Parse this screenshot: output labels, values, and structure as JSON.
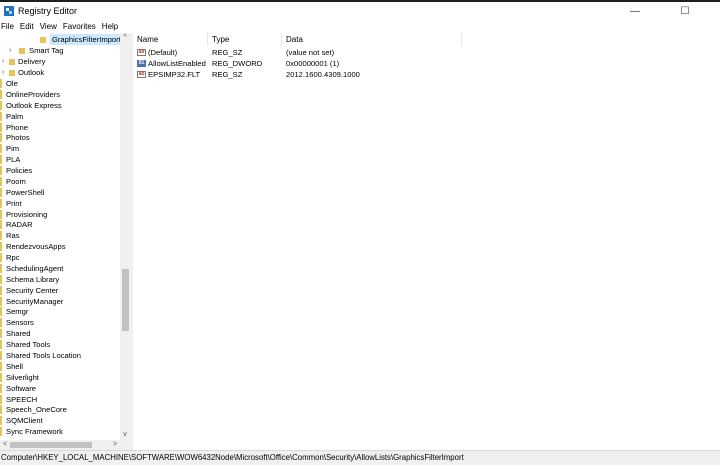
{
  "window": {
    "title": "Registry Editor",
    "minimize_glyph": "—",
    "maximize_glyph": "☐",
    "icon": "registry-editor-icon"
  },
  "menu": [
    "File",
    "Edit",
    "View",
    "Favorites",
    "Help"
  ],
  "tree": {
    "selected_key": "GraphicsFilterImport",
    "expanded_items": [
      {
        "label": "GraphicsFilterImport",
        "expander": "",
        "selected": true
      },
      {
        "label": "Smart Tag",
        "expander": "›"
      },
      {
        "label": "Delivery",
        "expander": "›"
      },
      {
        "label": "Outlook",
        "expander": "›"
      }
    ],
    "items": [
      "Ole",
      "OnlineProviders",
      "Outlook Express",
      "Palm",
      "Phone",
      "Photos",
      "Pim",
      "PLA",
      "Policies",
      "Poom",
      "PowerShell",
      "Print",
      "Provisioning",
      "RADAR",
      "Ras",
      "RendezvousApps",
      "Rpc",
      "SchedulingAgent",
      "Schema Library",
      "Security Center",
      "SecurityManager",
      "Semgr",
      "Sensors",
      "Shared",
      "Shared Tools",
      "Shared Tools Location",
      "Shell",
      "Silverlight",
      "Software",
      "SPEECH",
      "Speech_OneCore",
      "SQMClient",
      "Sync Framework"
    ],
    "scroll_up": "^",
    "scroll_down": "v",
    "scroll_left": "<",
    "scroll_right": ">"
  },
  "values": {
    "headers": {
      "name": "Name",
      "type": "Type",
      "data": "Data"
    },
    "rows": [
      {
        "icon": "string-value-icon",
        "badge": "ab",
        "name": "(Default)",
        "type": "REG_SZ",
        "data": "(value not set)"
      },
      {
        "icon": "binary-value-icon",
        "badge": "01",
        "name": "AllowListEnabled",
        "type": "REG_DWORD",
        "data": "0x00000001 (1)"
      },
      {
        "icon": "string-value-icon",
        "badge": "ab",
        "name": "EPSIMP32.FLT",
        "type": "REG_SZ",
        "data": "2012.1600.4309.1000"
      }
    ]
  },
  "status": {
    "path": "Computer\\HKEY_LOCAL_MACHINE\\SOFTWARE\\WOW6432Node\\Microsoft\\Office\\Common\\Security\\AllowLists\\GraphicsFilterImport"
  }
}
